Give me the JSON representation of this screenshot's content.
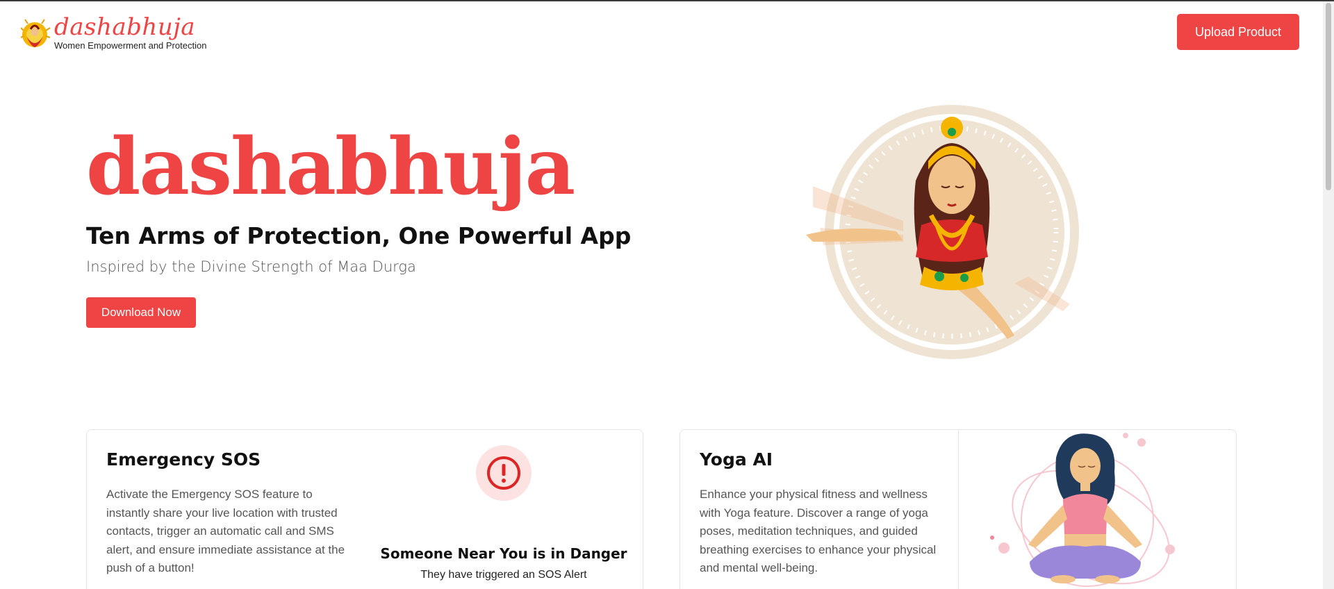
{
  "header": {
    "brand_name": "dashabhuja",
    "brand_tagline": "Women Empowerment and Protection",
    "upload_label": "Upload Product"
  },
  "hero": {
    "title": "dashabhuja",
    "subtitle": "Ten Arms of Protection, One Powerful App",
    "inspiration": "Inspired by the Divine Strength of Maa Durga",
    "download_label": "Download Now"
  },
  "cards": {
    "sos": {
      "title": "Emergency SOS",
      "description": "Activate the Emergency SOS feature to instantly share your live location with trusted contacts, trigger an automatic call and SMS alert, and ensure immediate assistance at the push of a button!",
      "alert_title": "Someone Near You is in Danger",
      "alert_text": "They have triggered an SOS Alert",
      "icon": "alert-circle-icon"
    },
    "yoga": {
      "title": "Yoga AI",
      "description": "Enhance your physical fitness and wellness with Yoga feature. Discover a range of yoga poses, meditation techniques, and guided breathing exercises to enhance your physical and mental well-being."
    }
  },
  "colors": {
    "accent": "#ef4444",
    "alert_bg": "#fde2e2",
    "gold": "#f5b400",
    "circle_bg": "#efe4d4",
    "yoga_pink": "#f0879a",
    "yoga_purple": "#9b87d9"
  }
}
